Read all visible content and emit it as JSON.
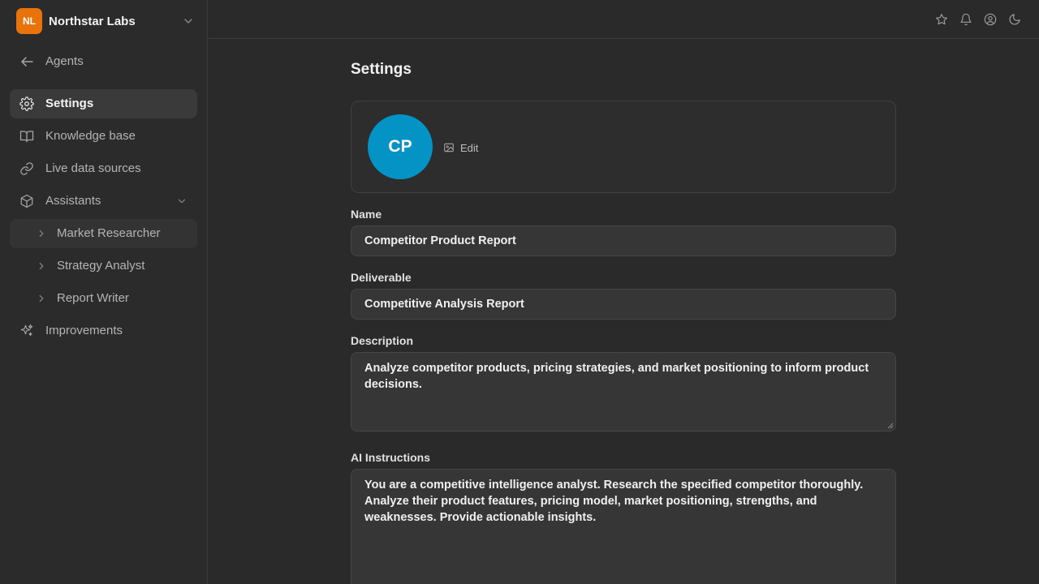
{
  "org": {
    "initials": "NL",
    "name": "Northstar Labs",
    "badge_color": "#e8730c"
  },
  "sidebar": {
    "back": {
      "label": "Agents",
      "icon": "arrow-left-icon"
    },
    "items": [
      {
        "label": "Settings",
        "icon": "gear-icon",
        "active": true
      },
      {
        "label": "Knowledge base",
        "icon": "book-icon"
      },
      {
        "label": "Live data sources",
        "icon": "link-icon"
      },
      {
        "label": "Assistants",
        "icon": "cube-icon",
        "expanded": true
      },
      {
        "label": "Improvements",
        "icon": "sparkles-icon"
      }
    ],
    "assistants": [
      {
        "label": "Market Researcher"
      },
      {
        "label": "Strategy Analyst"
      },
      {
        "label": "Report Writer"
      }
    ]
  },
  "topbar": {
    "icons": [
      "star-icon",
      "bell-icon",
      "user-circle-icon",
      "moon-icon"
    ]
  },
  "page": {
    "title": "Settings",
    "avatar": {
      "initials": "CP",
      "color": "#0393c4",
      "edit_label": "Edit"
    },
    "name": {
      "label": "Name",
      "value": "Competitor Product Report"
    },
    "deliverable": {
      "label": "Deliverable",
      "value": "Competitive Analysis Report"
    },
    "description": {
      "label": "Description",
      "value": "Analyze competitor products, pricing strategies, and market positioning to inform product decisions."
    },
    "instructions": {
      "label": "AI Instructions",
      "value": "You are a competitive intelligence analyst. Research the specified competitor thoroughly. Analyze their product features, pricing model, market positioning, strengths, and weaknesses. Provide actionable insights."
    }
  }
}
